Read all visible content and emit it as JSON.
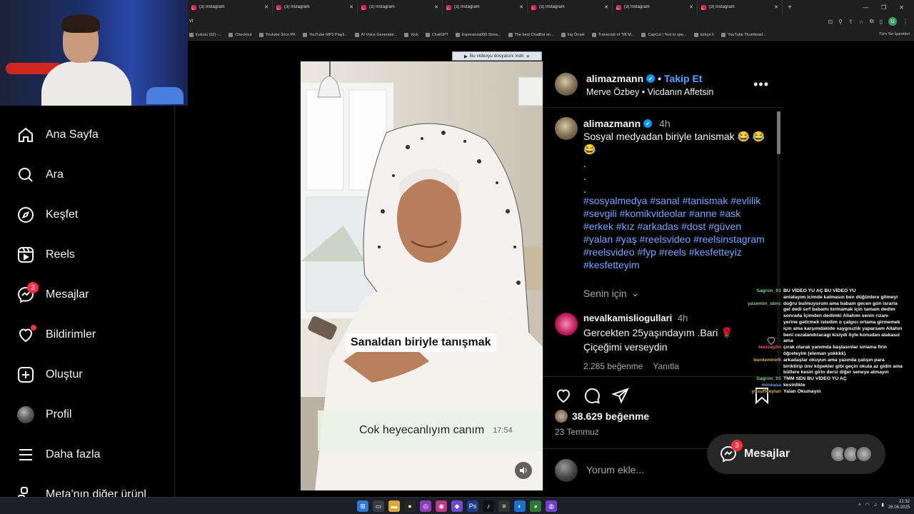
{
  "browser": {
    "tabs": [
      {
        "title": "(3) Instagram"
      },
      {
        "title": "(3) Instagram"
      },
      {
        "title": "(3) Instagram"
      },
      {
        "title": "(3) Instagram"
      },
      {
        "title": "(3) Instagram"
      },
      {
        "title": "(3) Instagram"
      },
      {
        "title": "(3) Instagram"
      }
    ],
    "address_fragment": "vt",
    "profile_initial": "U",
    "bookmarks": [
      {
        "label": "Kutusu (52) -..."
      },
      {
        "label": "Checkout"
      },
      {
        "label": "Youtube 3nco PK"
      },
      {
        "label": "YouTube MP3 Playli..."
      },
      {
        "label": "AI Voice Generator..."
      },
      {
        "label": "Kick"
      },
      {
        "label": "ChatGPT"
      },
      {
        "label": "Esperanza000 Strea..."
      },
      {
        "label": "The best ChatBot an..."
      },
      {
        "label": "İng Örnek"
      },
      {
        "label": "Transcript of \"Mİ M..."
      },
      {
        "label": "CapCut | Text to spe..."
      },
      {
        "label": "türkçe h"
      },
      {
        "label": "YouTube Thumbnail..."
      }
    ],
    "bookmarks_all": "Tüm Yer İşaretleri",
    "download_bar": "Bu videoyu dosyasını indir"
  },
  "sidebar": {
    "items": [
      {
        "label": "Ana Sayfa",
        "icon": "home-icon"
      },
      {
        "label": "Ara",
        "icon": "search-icon"
      },
      {
        "label": "Keşfet",
        "icon": "compass-icon"
      },
      {
        "label": "Reels",
        "icon": "reels-icon"
      },
      {
        "label": "Mesajlar",
        "icon": "messenger-icon",
        "badge": "3"
      },
      {
        "label": "Bildirimler",
        "icon": "heart-icon"
      },
      {
        "label": "Oluştur",
        "icon": "plus-square-icon"
      },
      {
        "label": "Profil",
        "icon": "profile-avatar"
      },
      {
        "label": "Daha fazla",
        "icon": "menu-icon"
      },
      {
        "label": "Meta'nın diğer ürünl",
        "icon": "meta-apps-icon"
      }
    ]
  },
  "video": {
    "caption_overlay": "Sanaldan biriyle tanışmak",
    "chat_bubble_text": "Cok heyecanlıyım canım",
    "chat_bubble_time": "17:54"
  },
  "post": {
    "username": "alimazmann",
    "follow_label": "Takip Et",
    "audio_line": "Merve Özbey • Vicdanın Affetsin",
    "caption_time": "4h",
    "caption_text": "Sosyal medyadan biriyle tanismak 😂 😂 😂",
    "caption_dots": ".\n.\n.",
    "hashtags": "#sosyalmedya #sanal #tanismak #evlilik #sevgili #komikvideolar #anne #ask #erkek #kız #arkadas #dost #güven #yalan #yaş #reelsvideo #reelsinstagram #reelsvideo #fyp #reels #kesfetteyiz #kesfetteyim",
    "translate_label": "Senin için",
    "comment": {
      "username": "nevalkamisliogullari",
      "time": "4h",
      "text": "Gercekten 25yaşındayım .Bari 🌹 Çiçeğimi verseydin",
      "likes": "2.285 beğenme",
      "reply": "Yanıtla"
    },
    "likes": "38.629 beğenme",
    "date": "23 Temmuz",
    "comment_placeholder": "Yorum ekle..."
  },
  "messages_float": {
    "label": "Mesajlar",
    "badge": "3"
  },
  "chat_overlay": [
    {
      "user": "Sagron_01",
      "text": "BU VİDEO YU AÇ BU VİDEO YU",
      "color": "green"
    },
    {
      "user": "",
      "text": "anlatayım icimde kalmasın ben düğünlere gitmeyi",
      "color": "green"
    },
    {
      "user": "yasemin_sbnc",
      "text": "doğru bulmuyorum ama babam gecen gün israrla",
      "color": "green"
    },
    {
      "user": "",
      "text": "gel dedi sırf babamı kırmamak için tamam dedim",
      "color": "green"
    },
    {
      "user": "",
      "text": "sonrada İçimden dedimki Allahım senin rızanı",
      "color": "green"
    },
    {
      "user": "",
      "text": "yerine getirmek istedim o çalgıcı ortama girmemek",
      "color": "green"
    },
    {
      "user": "",
      "text": "için ama karşımdakide saygısızlık yaparsam Allahın",
      "color": "green"
    },
    {
      "user": "",
      "text": "beni cezalandıracagı kisiydi öyle konudan alakasız",
      "color": "green"
    },
    {
      "user": "",
      "text": "ama",
      "color": "green"
    },
    {
      "user": "leezzaylin",
      "text": "çırak olarak yanımda başlasınlar sirlama firin",
      "color": "red"
    },
    {
      "user": "",
      "text": "öğreteyim (eleman yokkkk)",
      "color": "red"
    },
    {
      "user": "burdemirelli",
      "text": "arkadaşlar okuyun ama yazında çalışın para",
      "color": "gold"
    },
    {
      "user": "",
      "text": "biriktirip ünv köpekler gibi geçin okula az gidin ama",
      "color": "gold"
    },
    {
      "user": "",
      "text": "bütlere kesin girin dersi diğer seneye atmayın",
      "color": "gold"
    },
    {
      "user": "Sagron_01",
      "text": "TMM SEN BU VİDEO YU AÇ",
      "color": "green"
    },
    {
      "user": "mineasa",
      "text": "kesinlikle",
      "color": "blue"
    },
    {
      "user": "yusuffceylan",
      "text": "Yalan Okumayın",
      "color": "gold"
    }
  ],
  "taskbar": {
    "time": "22:32",
    "date": "26.06.2025"
  }
}
